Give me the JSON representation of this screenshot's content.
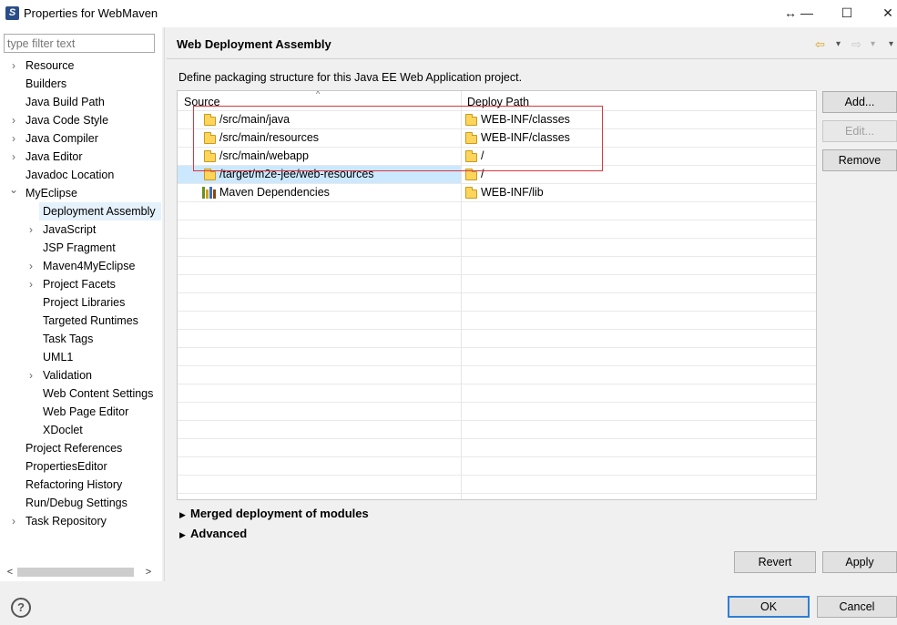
{
  "window": {
    "title": "Properties for WebMaven",
    "controls": {
      "restore": "↔",
      "minimize": "—",
      "maximize": "☐",
      "close": "✕"
    }
  },
  "filter": {
    "placeholder": "type filter text",
    "value": ""
  },
  "tree": [
    {
      "label": "Resource",
      "expandable": true,
      "depth": 0
    },
    {
      "label": "Builders",
      "expandable": false,
      "depth": 0
    },
    {
      "label": "Java Build Path",
      "expandable": false,
      "depth": 0
    },
    {
      "label": "Java Code Style",
      "expandable": true,
      "depth": 0
    },
    {
      "label": "Java Compiler",
      "expandable": true,
      "depth": 0
    },
    {
      "label": "Java Editor",
      "expandable": true,
      "depth": 0
    },
    {
      "label": "Javadoc Location",
      "expandable": false,
      "depth": 0
    },
    {
      "label": "MyEclipse",
      "expandable": true,
      "expanded": true,
      "depth": 0
    },
    {
      "label": "Deployment Assembly",
      "expandable": false,
      "depth": 1,
      "selected": true
    },
    {
      "label": "JavaScript",
      "expandable": true,
      "depth": 1
    },
    {
      "label": "JSP Fragment",
      "expandable": false,
      "depth": 1
    },
    {
      "label": "Maven4MyEclipse",
      "expandable": true,
      "depth": 1
    },
    {
      "label": "Project Facets",
      "expandable": true,
      "depth": 1
    },
    {
      "label": "Project Libraries",
      "expandable": false,
      "depth": 1
    },
    {
      "label": "Targeted Runtimes",
      "expandable": false,
      "depth": 1
    },
    {
      "label": "Task Tags",
      "expandable": false,
      "depth": 1
    },
    {
      "label": "UML1",
      "expandable": false,
      "depth": 1
    },
    {
      "label": "Validation",
      "expandable": true,
      "depth": 1
    },
    {
      "label": "Web Content Settings",
      "expandable": false,
      "depth": 1
    },
    {
      "label": "Web Page Editor",
      "expandable": false,
      "depth": 1
    },
    {
      "label": "XDoclet",
      "expandable": false,
      "depth": 1
    },
    {
      "label": "Project References",
      "expandable": false,
      "depth": 0
    },
    {
      "label": "PropertiesEditor",
      "expandable": false,
      "depth": 0
    },
    {
      "label": "Refactoring History",
      "expandable": false,
      "depth": 0
    },
    {
      "label": "Run/Debug Settings",
      "expandable": false,
      "depth": 0
    },
    {
      "label": "Task Repository",
      "expandable": true,
      "depth": 0
    }
  ],
  "page": {
    "title": "Web Deployment Assembly",
    "description": "Define packaging structure for this Java EE Web Application project.",
    "nav": {
      "back": "⇦",
      "back_menu": "▾",
      "forward": "⇨",
      "forward_menu": "▾",
      "view_menu": "▾"
    }
  },
  "table": {
    "headers": {
      "source": "Source",
      "deploy_path": "Deploy Path"
    },
    "rows": [
      {
        "source": "/src/main/java",
        "deploy": "WEB-INF/classes",
        "icon": "folder-icon",
        "selected": false
      },
      {
        "source": "/src/main/resources",
        "deploy": "WEB-INF/classes",
        "icon": "folder-icon",
        "selected": false
      },
      {
        "source": "/src/main/webapp",
        "deploy": "/",
        "icon": "folder-icon",
        "selected": false
      },
      {
        "source": "/target/m2e-jee/web-resources",
        "deploy": "/",
        "icon": "folder-icon",
        "selected": true
      },
      {
        "source": "Maven Dependencies",
        "deploy": "WEB-INF/lib",
        "icon": "library-icon",
        "selected": false
      }
    ],
    "empty_rows": 16
  },
  "side_buttons": {
    "add": "Add...",
    "edit": "Edit...",
    "remove": "Remove"
  },
  "sections": {
    "merged": "Merged deployment of modules",
    "advanced": "Advanced"
  },
  "footer": {
    "revert": "Revert",
    "apply": "Apply",
    "ok": "OK",
    "cancel": "Cancel",
    "help": "?"
  },
  "colors": {
    "selection": "#cce8ff",
    "tree_selection": "#e5f1fb",
    "highlight_border": "#d9363e",
    "default_button_border": "#2f7fd4"
  }
}
